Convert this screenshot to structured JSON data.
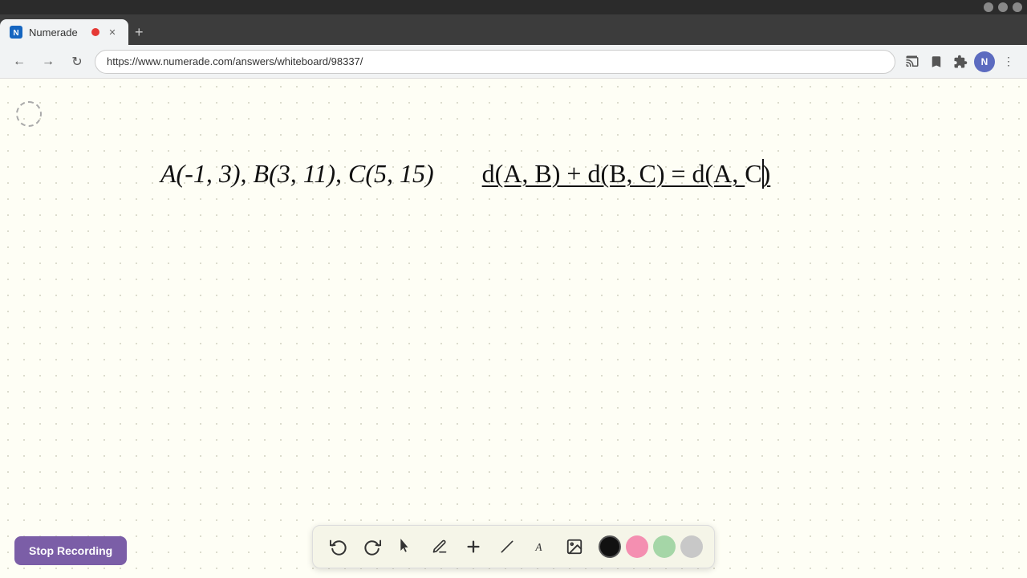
{
  "browser": {
    "title": "Numerade",
    "url": "https://www.numerade.com/answers/whiteboard/98337/",
    "favicon_letter": "N",
    "recording_dot": true
  },
  "toolbar": {
    "undo_label": "⟲",
    "redo_label": "⟳",
    "stop_recording_label": "Stop Recording"
  },
  "whiteboard": {
    "math_left": "A(-1, 3), B(3, 11), C(5, 15)",
    "math_right_underlined": "d(A, B) + d(B, C) = d(A, C)"
  },
  "tools": [
    {
      "name": "undo",
      "icon": "↩",
      "label": "Undo"
    },
    {
      "name": "redo",
      "icon": "↪",
      "label": "Redo"
    },
    {
      "name": "select",
      "icon": "▲",
      "label": "Select"
    },
    {
      "name": "pen",
      "icon": "✏",
      "label": "Pen"
    },
    {
      "name": "add",
      "icon": "+",
      "label": "Add"
    },
    {
      "name": "eraser",
      "icon": "╱",
      "label": "Eraser"
    },
    {
      "name": "text",
      "icon": "A",
      "label": "Text"
    },
    {
      "name": "image",
      "icon": "🖼",
      "label": "Image"
    }
  ],
  "colors": [
    {
      "name": "black",
      "hex": "#111111",
      "active": true
    },
    {
      "name": "pink",
      "hex": "#f48fb1"
    },
    {
      "name": "mint",
      "hex": "#a5d6a7"
    },
    {
      "name": "light-gray",
      "hex": "#c0c0c0"
    }
  ]
}
